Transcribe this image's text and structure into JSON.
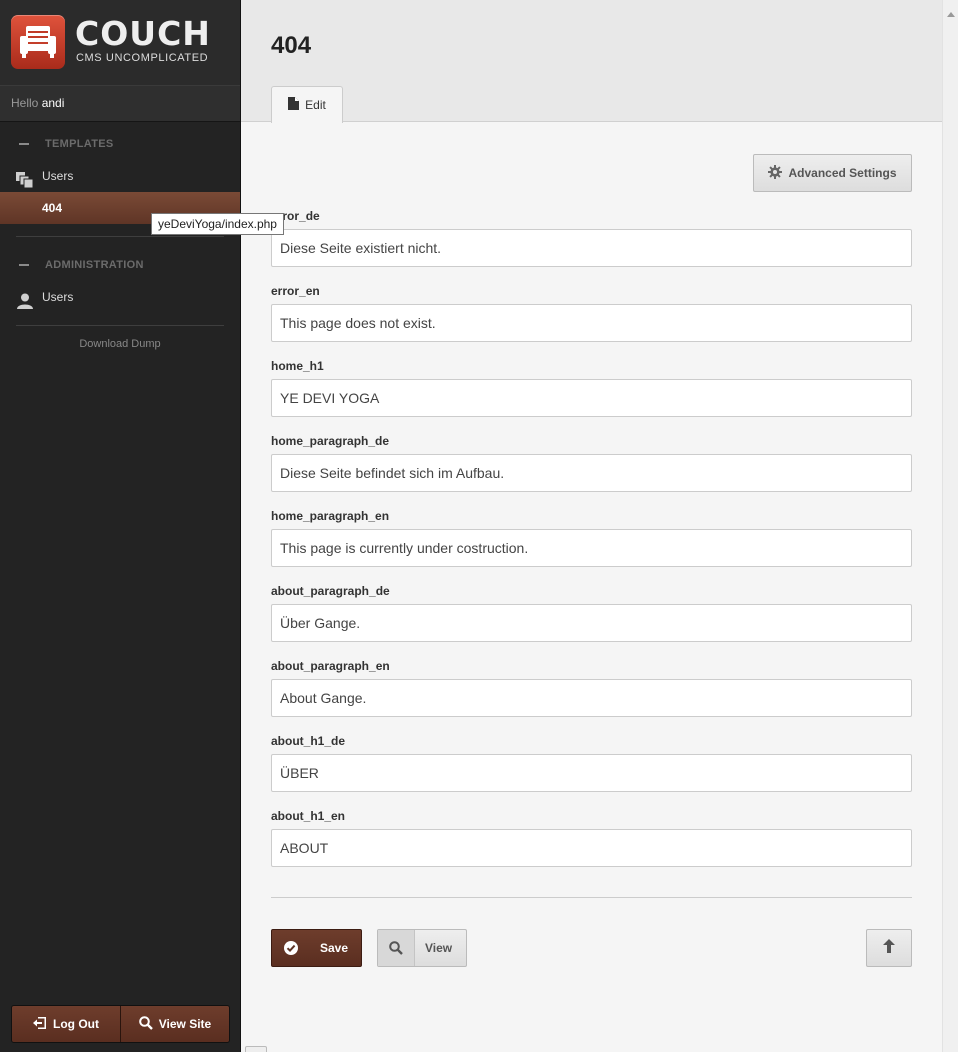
{
  "brand": {
    "title": "COUCH",
    "subtitle": "CMS UNCOMPLICATED"
  },
  "greeting": {
    "prefix": "Hello",
    "user": "andi"
  },
  "sidebar": {
    "templates_heading": "TEMPLATES",
    "templates": [
      {
        "label": "Users",
        "icon": "stacked-pages-icon"
      },
      {
        "label": "404",
        "active": true
      }
    ],
    "tooltip": "yeDeviYoga/index.php",
    "admin_heading": "ADMINISTRATION",
    "admin_items": [
      {
        "label": "Users",
        "icon": "user-icon"
      }
    ],
    "download_label": "Download Dump",
    "logout_label": "Log Out",
    "viewsite_label": "View Site"
  },
  "page": {
    "title": "404",
    "tab_label": "Edit",
    "advanced_label": "Advanced Settings"
  },
  "fields": [
    {
      "label": "error_de",
      "value": "Diese Seite existiert nicht."
    },
    {
      "label": "error_en",
      "value": "This page does not exist."
    },
    {
      "label": "home_h1",
      "value": "YE DEVI YOGA"
    },
    {
      "label": "home_paragraph_de",
      "value": "Diese Seite befindet sich im Aufbau."
    },
    {
      "label": "home_paragraph_en",
      "value": "This page is currently under costruction."
    },
    {
      "label": "about_paragraph_de",
      "value": "Über Gange."
    },
    {
      "label": "about_paragraph_en",
      "value": "About Gange."
    },
    {
      "label": "about_h1_de",
      "value": "ÜBER"
    },
    {
      "label": "about_h1_en",
      "value": "ABOUT"
    }
  ],
  "actions": {
    "save_label": "Save",
    "view_label": "View"
  },
  "colors": {
    "accent": "#6e3d2c",
    "sidebar_bg": "#232323",
    "logo_red": "#d2412c"
  }
}
